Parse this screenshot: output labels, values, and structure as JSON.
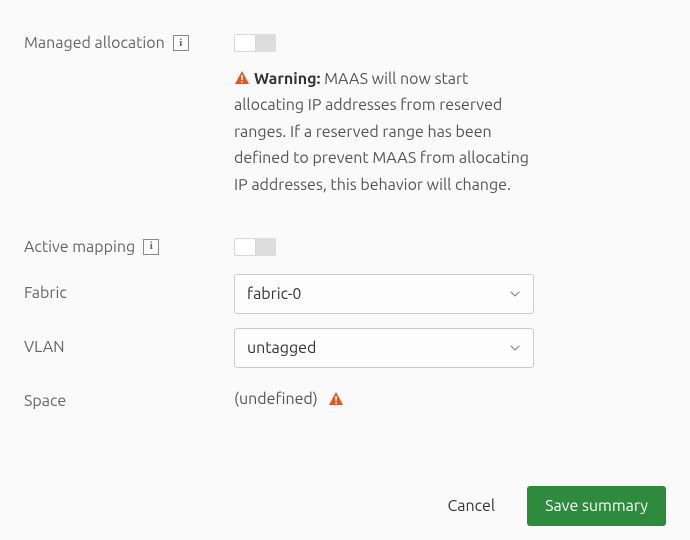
{
  "fields": {
    "managed_allocation": {
      "label": "Managed allocation",
      "info_glyph": "i"
    },
    "active_mapping": {
      "label": "Active mapping",
      "info_glyph": "i"
    },
    "fabric": {
      "label": "Fabric",
      "value": "fabric-0"
    },
    "vlan": {
      "label": "VLAN",
      "value": "untagged"
    },
    "space": {
      "label": "Space",
      "value": "(undefined)"
    }
  },
  "warning": {
    "label": "Warning:",
    "text": " MAAS will now start allocating IP addresses from reserved ranges. If a reserved range has been defined to prevent MAAS from allocating IP addresses, this behavior will change."
  },
  "actions": {
    "cancel": "Cancel",
    "save": "Save summary"
  }
}
